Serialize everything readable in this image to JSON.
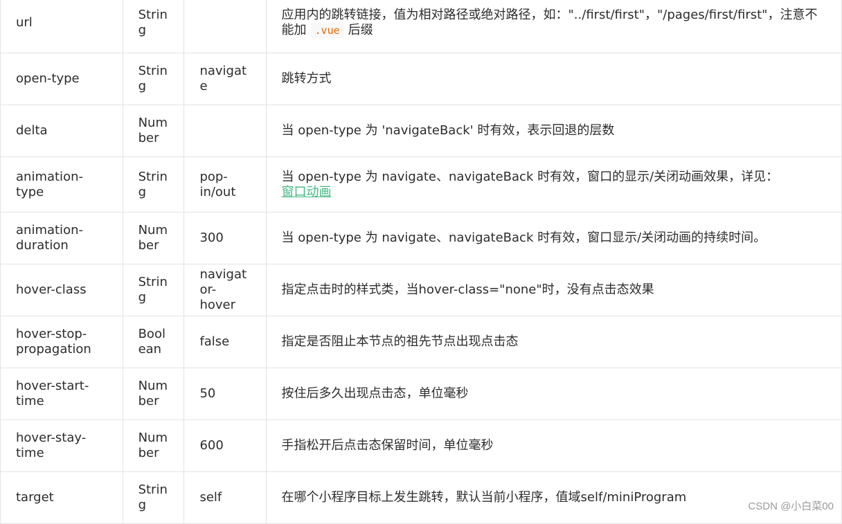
{
  "rows": [
    {
      "name": "url",
      "type": "String",
      "default": "",
      "desc_pre": "应用内的跳转链接，值为相对路径或绝对路径，如：\"../first/first\"，\"/pages/first/first\"，注意不能加",
      "desc_code": ".vue",
      "desc_post": "后缀"
    },
    {
      "name": "open-type",
      "type": "String",
      "default": "navigate",
      "desc": "跳转方式"
    },
    {
      "name": "delta",
      "type": "Number",
      "default": "",
      "desc": "当 open-type 为 'navigateBack' 时有效，表示回退的层数"
    },
    {
      "name": "animation-type",
      "type": "String",
      "default": "pop-in/out",
      "desc": "当 open-type 为 navigate、navigateBack 时有效，窗口的显示/关闭动画效果，详见：",
      "desc_link": "窗口动画"
    },
    {
      "name": "animation-duration",
      "type": "Number",
      "default": "300",
      "desc": "当 open-type 为 navigate、navigateBack 时有效，窗口显示/关闭动画的持续时间。"
    },
    {
      "name": "hover-class",
      "type": "String",
      "default": "navigator-hover",
      "desc": "指定点击时的样式类，当hover-class=\"none\"时，没有点击态效果"
    },
    {
      "name": "hover-stop-propagation",
      "type": "Boolean",
      "default": "false",
      "desc": "指定是否阻止本节点的祖先节点出现点击态"
    },
    {
      "name": "hover-start-time",
      "type": "Number",
      "default": "50",
      "desc": "按住后多久出现点击态，单位毫秒"
    },
    {
      "name": "hover-stay-time",
      "type": "Number",
      "default": "600",
      "desc": "手指松开后点击态保留时间，单位毫秒"
    },
    {
      "name": "target",
      "type": "String",
      "default": "self",
      "desc": "在哪个小程序目标上发生跳转，默认当前小程序，值域self/miniProgram"
    }
  ],
  "watermark": "CSDN @小白菜00"
}
